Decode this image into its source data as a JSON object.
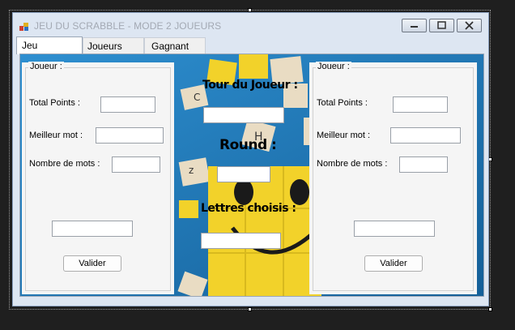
{
  "window": {
    "title": "JEU DU SCRABBLE - MODE 2 JOUEURS"
  },
  "tabs": [
    {
      "label": "Jeu"
    },
    {
      "label": "Joueurs"
    },
    {
      "label": "Gagnant"
    }
  ],
  "left_player": {
    "group_label": "Joueur :",
    "total_points_label": "Total Points :",
    "best_word_label": "Meilleur mot :",
    "word_count_label": "Nombre de mots :",
    "total_points_value": "",
    "best_word_value": "",
    "word_count_value": "",
    "word_entry_value": "",
    "validate_label": "Valider"
  },
  "right_player": {
    "group_label": "Joueur :",
    "total_points_label": "Total Points :",
    "best_word_label": "Meilleur mot :",
    "word_count_label": "Nombre de mots :",
    "total_points_value": "",
    "best_word_value": "",
    "word_count_value": "",
    "word_entry_value": "",
    "validate_label": "Valider"
  },
  "center": {
    "turn_label": "Tour du Joueur :",
    "turn_value": "",
    "round_label": "Round :",
    "round_value": "",
    "letters_label": "Lettres choisis :",
    "letters_value": ""
  },
  "colors": {
    "background_blue": "#1d7ab8",
    "tile_yellow": "#f2d22a",
    "tile_cream": "#e9dcc3"
  }
}
